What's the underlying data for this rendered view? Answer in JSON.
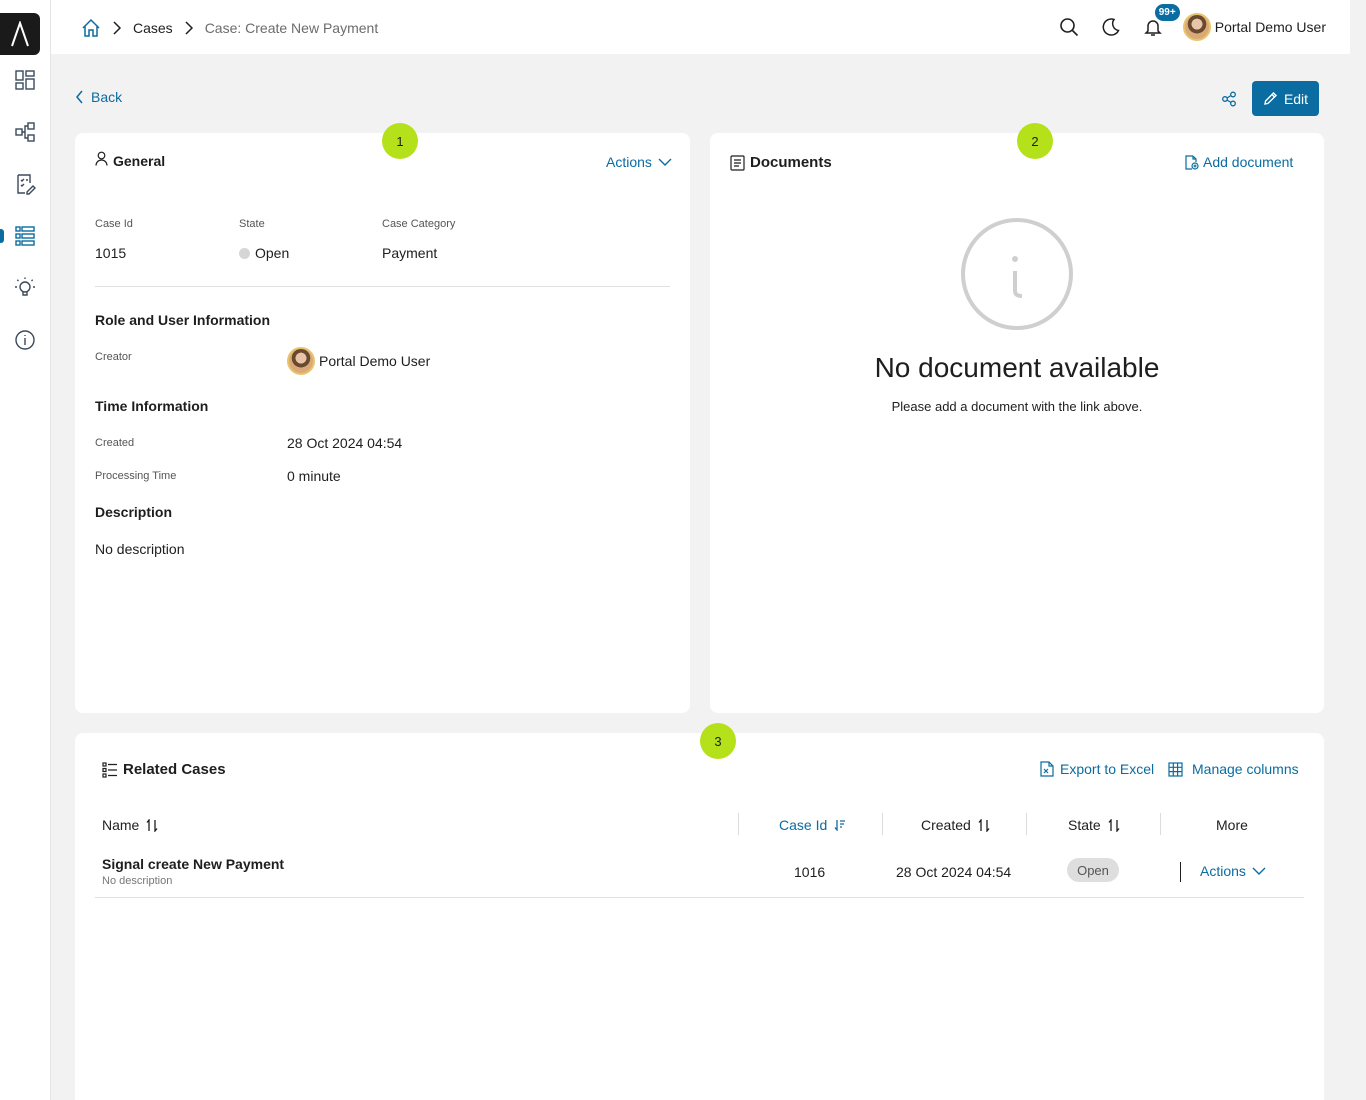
{
  "header": {
    "breadcrumb_cases": "Cases",
    "breadcrumb_current": "Case: Create New Payment",
    "notification_count": "99+",
    "user_name": "Portal Demo User"
  },
  "toolbar": {
    "back_label": "Back",
    "edit_label": "Edit"
  },
  "badges": {
    "general": "1",
    "documents": "2",
    "related": "3"
  },
  "general": {
    "title": "General",
    "actions_label": "Actions",
    "case_id_label": "Case Id",
    "case_id_value": "1015",
    "state_label": "State",
    "state_value": "Open",
    "category_label": "Case Category",
    "category_value": "Payment",
    "role_section_title": "Role and User Information",
    "creator_label": "Creator",
    "creator_value": "Portal Demo User",
    "time_section_title": "Time Information",
    "created_label": "Created",
    "created_value": "28 Oct 2024 04:54",
    "processing_label": "Processing Time",
    "processing_value": "0 minute",
    "description_title": "Description",
    "description_value": "No description"
  },
  "documents": {
    "title": "Documents",
    "add_label": "Add document",
    "empty_title": "No document available",
    "empty_hint": "Please add a document with the link above."
  },
  "related": {
    "title": "Related Cases",
    "export_label": "Export to Excel",
    "manage_columns_label": "Manage columns",
    "columns": {
      "name": "Name",
      "case_id": "Case Id",
      "created": "Created",
      "state": "State",
      "more": "More"
    },
    "rows": [
      {
        "name": "Signal create New Payment",
        "description": "No description",
        "case_id": "1016",
        "created": "28 Oct 2024 04:54",
        "state": "Open",
        "actions": "Actions"
      }
    ]
  },
  "colors": {
    "primary": "#0a6ca0",
    "badge_green": "#b4e11a",
    "background": "#f2f2f2"
  },
  "icons": {
    "sidebar": [
      "logo-icon",
      "dashboard-icon",
      "process-icon",
      "task-icon",
      "case-list-icon",
      "idea-icon",
      "info-icon"
    ],
    "header": [
      "home-icon",
      "search-icon",
      "dark-mode-icon",
      "bell-icon"
    ]
  }
}
